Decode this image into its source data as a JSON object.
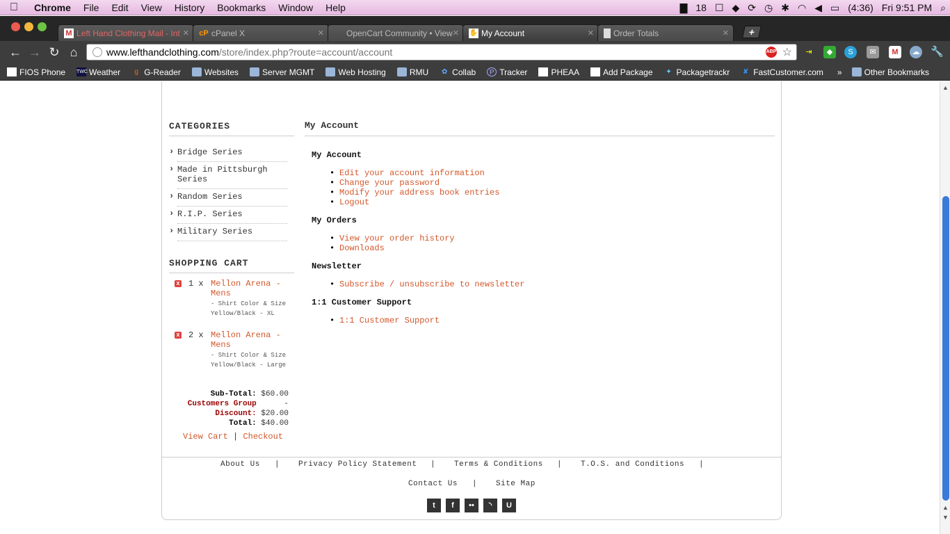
{
  "menubar": {
    "apple": "",
    "app": "Chrome",
    "items": [
      "File",
      "Edit",
      "View",
      "History",
      "Bookmarks",
      "Window",
      "Help"
    ],
    "status": {
      "badge_count": "18",
      "battery": "(4:36)",
      "clock": "Fri 9:51 PM"
    }
  },
  "tabs": [
    {
      "title": "Left Hand Clothing Mail - Int",
      "icon": "gmail-icon"
    },
    {
      "title": "cPanel X",
      "icon": "cpanel-icon"
    },
    {
      "title": "OpenCart Community • View",
      "icon": "page-icon"
    },
    {
      "title": "My Account",
      "icon": "store-icon",
      "active": true
    },
    {
      "title": "Order Totals",
      "icon": "page-icon"
    }
  ],
  "address": {
    "domain": "www.lefthandclothing.com",
    "path": "/store/index.php?route=account/account"
  },
  "bookmarks": [
    "FIOS Phone",
    "Weather",
    "G-Reader",
    "Websites",
    "Server MGMT",
    "Web Hosting",
    "RMU",
    "Collab",
    "Tracker",
    "PHEAA",
    "Add Package",
    "Packagetrackr",
    "FastCustomer.com"
  ],
  "bookmarks_overflow": "»",
  "other_bookmarks": "Other Bookmarks",
  "sidebar": {
    "categories_title": "CATEGORIES",
    "categories": [
      "Bridge Series",
      "Made in Pittsburgh Series",
      "Random Series",
      "R.I.P. Series",
      "Military Series"
    ],
    "cart_title": "SHOPPING CART",
    "cart": [
      {
        "qty": "1 x",
        "name": "Mellon Arena - Mens",
        "option": "- Shirt Color & Size Yellow/Black - XL"
      },
      {
        "qty": "2 x",
        "name": "Mellon Arena - Mens",
        "option": "- Shirt Color & Size Yellow/Black - Large"
      }
    ],
    "subtotal_label": "Sub-Total:",
    "subtotal": "$60.00",
    "discount_label_1": "Customers Group",
    "discount_dash": "-",
    "discount_label_2": "Discount:",
    "discount": "$20.00",
    "total_label": "Total:",
    "total": "$40.00",
    "view_cart": "View Cart",
    "sep": "|",
    "checkout": "Checkout"
  },
  "main": {
    "title": "My Account",
    "sections": [
      {
        "heading": "My Account",
        "links": [
          "Edit your account information",
          "Change your password",
          "Modify your address book entries",
          "Logout"
        ]
      },
      {
        "heading": "My Orders",
        "links": [
          "View your order history",
          "Downloads"
        ]
      },
      {
        "heading": "Newsletter",
        "links": [
          "Subscribe / unsubscribe to newsletter"
        ]
      },
      {
        "heading": "1:1 Customer Support",
        "links": [
          "1:1 Customer Support"
        ]
      }
    ]
  },
  "footer": {
    "row1": [
      "About Us",
      "Privacy Policy Statement",
      "Terms & Conditions",
      "T.O.S. and Conditions"
    ],
    "row2": [
      "Contact Us",
      "Site Map"
    ],
    "sep": "|",
    "social": [
      "twitter-icon",
      "facebook-icon",
      "flickr-icon",
      "rss-icon",
      "ustream-icon"
    ],
    "social_glyphs": [
      "t",
      "f",
      "••",
      "◝",
      "U"
    ]
  }
}
